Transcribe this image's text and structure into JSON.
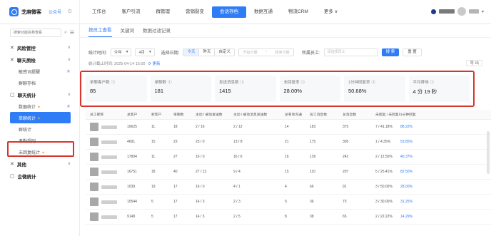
{
  "brand": {
    "name": "芝麻微客",
    "account": "公众号"
  },
  "nav": [
    "工作台",
    "客户引流",
    "群管理",
    "营销裂变",
    "会话存档",
    "数据互通",
    "物流CRM",
    "更多 ∨"
  ],
  "nav_active_index": 4,
  "sidebar": {
    "search_placeholder": "搜索功能名称查看",
    "groups": [
      {
        "title": "风险管控",
        "icon": "shield-icon",
        "chevron": "∨",
        "items": []
      },
      {
        "title": "聊天质检",
        "icon": "chat-check-icon",
        "chevron": "∧",
        "items": [
          {
            "label": "敏感词提醒",
            "star": true
          },
          {
            "label": "群聊存档",
            "star": false
          }
        ]
      },
      {
        "title": "聊天统计",
        "icon": "stats-icon",
        "chevron": "∧",
        "items": [
          {
            "label": "数据统计",
            "star": true,
            "hot": true
          },
          {
            "label": "单聊统计",
            "selected": true,
            "hot": true
          },
          {
            "label": "群统计",
            "star": false
          },
          {
            "label": "考勤规则",
            "star": false
          },
          {
            "label": "未回复统计",
            "hot": true
          }
        ]
      },
      {
        "title": "其他",
        "icon": "other-icon",
        "chevron": "∨",
        "items": []
      },
      {
        "title": "企微统计",
        "icon": "enterprise-icon",
        "chevron": "",
        "items": []
      }
    ]
  },
  "tabs": [
    "按员工查看",
    "关键词",
    "数据过滤记录"
  ],
  "filters": {
    "time_label": "统计时间:",
    "time_unit": "今年",
    "month": "4月",
    "date_label": "选择日期:",
    "segments": [
      "今天",
      "昨天",
      "自定义"
    ],
    "date_start": "开始日期",
    "date_end": "结束日期",
    "staff_label": "所属员工:",
    "staff_placeholder": "请选择员工",
    "search_btn": "搜 索",
    "reset_btn": "重 置"
  },
  "asof": {
    "text": "统计截止时间: 2025-04-14 15:00",
    "refresh": "更新",
    "export": "导 出"
  },
  "stats": [
    {
      "label": "单聊客户数",
      "value": "85"
    },
    {
      "label": "单聊数",
      "value": "181"
    },
    {
      "label": "发送消息数",
      "value": "1415"
    },
    {
      "label": "未回复率",
      "value": "28.00%"
    },
    {
      "label": "1分钟回复率",
      "value": "50.68%"
    },
    {
      "label": "平均首响",
      "value": "4 分 19 秒"
    }
  ],
  "table": {
    "headers": [
      "员工昵称",
      "总客户",
      "新客户",
      "单聊数",
      "主动 / 被动发送数",
      "主动 / 被动消息发送数",
      "总有效沟通",
      "员工消息数",
      "总消息数",
      "未回复 / 未回复率",
      "1分钟回复"
    ],
    "rows": [
      [
        "10625",
        "11",
        "18",
        "2 / 16",
        "2 / 12",
        "14",
        "183",
        "375",
        "7 / 41.18%",
        "88.22%"
      ],
      [
        "4691",
        "15",
        "23",
        "23 / 0",
        "13 / 8",
        "21",
        "175",
        "305",
        "1 / 4.35%",
        "53.85%"
      ],
      [
        "17804",
        "11",
        "27",
        "16 / 0",
        "16 / 6",
        "16",
        "139",
        "242",
        "2 / 12.50%",
        "40.37%"
      ],
      [
        "16751",
        "18",
        "40",
        "27 / 13",
        "9 / 4",
        "15",
        "110",
        "207",
        "5 / 25.41%",
        "82.50%"
      ],
      [
        "1039",
        "19",
        "17",
        "16 / 0",
        "4 / 1",
        "4",
        "66",
        "91",
        "3 / 50.00%",
        "28.00%"
      ],
      [
        "10544",
        "5",
        "17",
        "14 / 3",
        "2 / 3",
        "5",
        "36",
        "73",
        "3 / 30.00%",
        "31.25%"
      ],
      [
        "9148",
        "5",
        "17",
        "14 / 3",
        "2 / 5",
        "8",
        "38",
        "65",
        "2 / 22.22%",
        "14.29%"
      ]
    ]
  },
  "colors": {
    "accent": "#2f7df6",
    "highlight": "#d9342b"
  }
}
